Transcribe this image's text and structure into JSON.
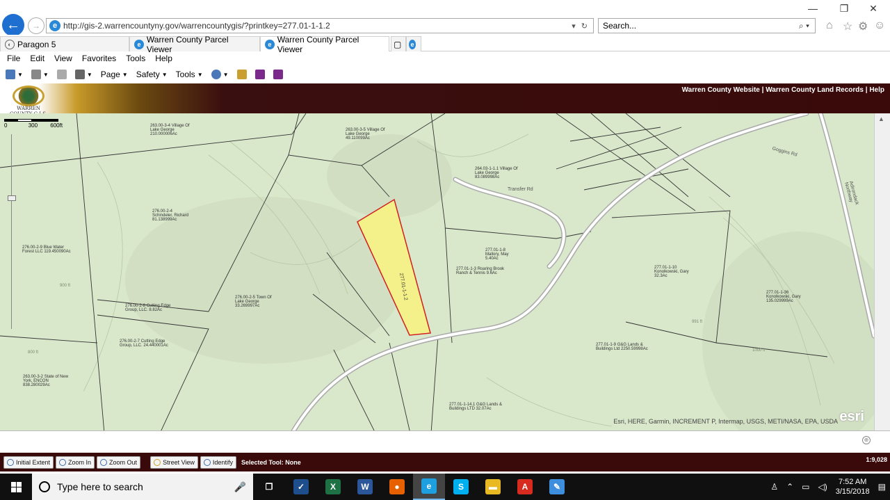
{
  "browser": {
    "url": "http://gis-2.warrencountyny.gov/warrencountygis/?printkey=277.01-1-1.2",
    "search_placeholder": "Search...",
    "tabs": [
      {
        "label": "Paragon 5"
      },
      {
        "label": "Warren County Parcel Viewer"
      },
      {
        "label": "Warren County Parcel Viewer"
      }
    ],
    "menu": [
      "File",
      "Edit",
      "View",
      "Favorites",
      "Tools",
      "Help"
    ],
    "commands": {
      "page": "Page",
      "safety": "Safety",
      "tools": "Tools"
    }
  },
  "header": {
    "logo_caption": "WARREN COUNTY G.I.S.",
    "links": [
      "Warren County Website",
      "Warren County Land Records",
      "Help"
    ],
    "separator": " | "
  },
  "map": {
    "scale_labels": [
      "0",
      "300",
      "600ft"
    ],
    "attribution": "Esri, HERE, Garmin, INCREMENT P, Intermap, USGS, METI/NASA, EPA, USDA",
    "esri": "esri",
    "selected_parcel": {
      "id": "277.01-1-1.2"
    },
    "parcels": [
      {
        "text": "263.00-3-4 Village Of Lake George 210.000006Ac"
      },
      {
        "text": "263.00-3-5 Village Of Lake George 49.110099Ac"
      },
      {
        "text": "264.03-1-1.1 Village Of Lake George 83.089998Ac"
      },
      {
        "text": "276.00-2-4 Schindeler, Richard 81.138999Ac"
      },
      {
        "text": "276.00-2-9 Blue Water Forest LLC 119.450090Ac"
      },
      {
        "text": "276.00-2-5 Town Of Lake George 33.269997Ac"
      },
      {
        "text": "276.00-2-8 Cutting Edge Group, LLC. 8.82Ac"
      },
      {
        "text": "276.00-2-7 Cutting Edge Group, LLC. 24.440001Ac"
      },
      {
        "text": "263.00-3-2 State of New York, ENCON 838.280029Ac"
      },
      {
        "text": "277.01-1-10 Konolkowski, Gary 32.3Ac"
      },
      {
        "text": "277.01-1-36 Konolkowski, Gary 135.029999Ac"
      },
      {
        "text": "277.01-1-9 G&G Lands & Buildings Ltd 2250.59998Ac"
      },
      {
        "text": "277.01-1-14.1 G&G Lands & Buildings LTD 32.07Ac"
      },
      {
        "text": "277.01-1-8 Mallory, May 5.40Ac"
      },
      {
        "text": "277.01-1-3 Roaring Brook Ranch & Tennis 9.6Ac"
      }
    ],
    "roads": [
      {
        "name": "Transfer Rd"
      },
      {
        "name": "Goggins Rd"
      },
      {
        "name": "Adirondack Northway"
      }
    ],
    "elevations": [
      "800 ft",
      "991 ft",
      "900 ft",
      "1000 ft"
    ]
  },
  "toolbar": {
    "buttons": [
      "Initial Extent",
      "Zoom In",
      "Zoom Out",
      "Street View",
      "Identify"
    ],
    "selected_tool": "Selected Tool: None",
    "scale": "1:9,028"
  },
  "taskbar": {
    "search_placeholder": "Type here to search",
    "time": "7:52 AM",
    "date": "3/15/2018",
    "apps": [
      {
        "name": "task-view",
        "color": "#101010",
        "glyph": "❐"
      },
      {
        "name": "mail",
        "color": "#1e4e8c",
        "glyph": "✓"
      },
      {
        "name": "excel",
        "color": "#1e7145",
        "glyph": "X"
      },
      {
        "name": "word",
        "color": "#2b579a",
        "glyph": "W"
      },
      {
        "name": "firefox",
        "color": "#e66000",
        "glyph": "●"
      },
      {
        "name": "internet-explorer",
        "color": "#1ea0e0",
        "glyph": "e"
      },
      {
        "name": "skype",
        "color": "#00aff0",
        "glyph": "S"
      },
      {
        "name": "file-explorer",
        "color": "#e8b923",
        "glyph": "▬"
      },
      {
        "name": "acrobat",
        "color": "#d82b1f",
        "glyph": "A"
      },
      {
        "name": "paint",
        "color": "#3e8ede",
        "glyph": "✎"
      }
    ]
  }
}
